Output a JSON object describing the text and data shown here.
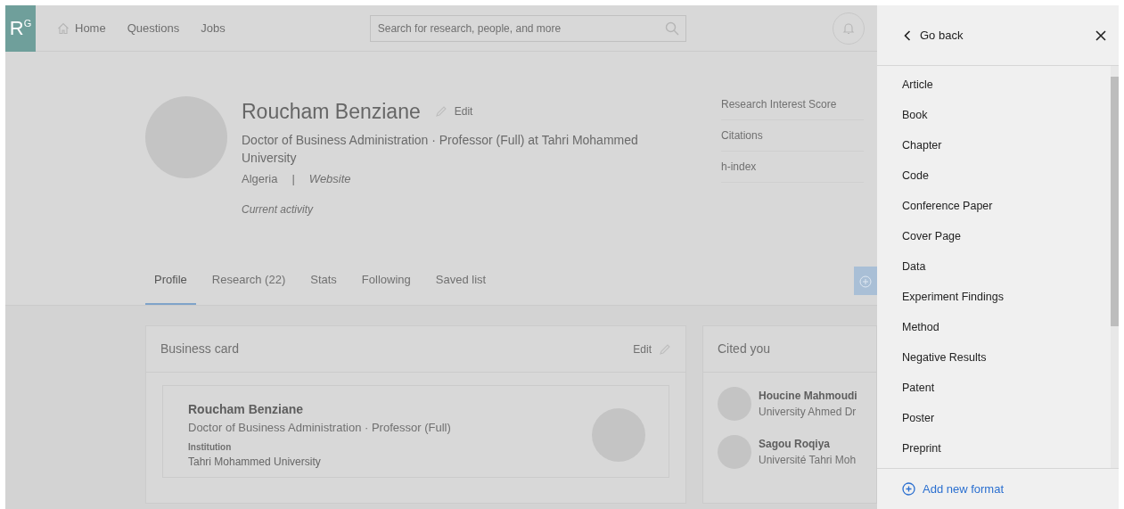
{
  "navbar": {
    "logo": "R$^{G}$",
    "links": [
      {
        "label": "Home"
      },
      {
        "label": "Questions"
      },
      {
        "label": "Jobs"
      }
    ],
    "search": {
      "placeholder": "Search for research, people, and more"
    }
  },
  "profile": {
    "name": "Roucham Benziane",
    "edit": "Edit",
    "headline": "Doctor of Business Administration · Professor (Full) at Tahri Mohammed University",
    "location": "Algeria",
    "separator": "|",
    "website": "Website",
    "activity": "Current activity",
    "stats": [
      "Research Interest Score",
      "Citations",
      "h-index"
    ]
  },
  "tabs": [
    {
      "label": "Profile",
      "selected": true
    },
    {
      "label": "Research (22)",
      "selected": false
    },
    {
      "label": "Stats",
      "selected": false
    },
    {
      "label": "Following",
      "selected": false
    },
    {
      "label": "Saved list",
      "selected": false
    }
  ],
  "business_card": {
    "title": "Business card",
    "edit": "Edit",
    "name": "Roucham Benziane",
    "headline": "Doctor of Business Administration · Professor (Full)",
    "institution_label": "Institution",
    "institution": "Tahri Mohammed University"
  },
  "cited_you": {
    "title": "Cited you",
    "people": [
      {
        "name": "Houcine Mahmoudi",
        "affiliation": "University Ahmed Dr"
      },
      {
        "name": "Sagou Roqiya",
        "affiliation": "Université Tahri Moh"
      }
    ]
  },
  "panel": {
    "back": "Go back",
    "formats": [
      "Article",
      "Book",
      "Chapter",
      "Code",
      "Conference Paper",
      "Cover Page",
      "Data",
      "Experiment Findings",
      "Method",
      "Negative Results",
      "Patent",
      "Poster",
      "Preprint"
    ],
    "add": "Add new format"
  }
}
